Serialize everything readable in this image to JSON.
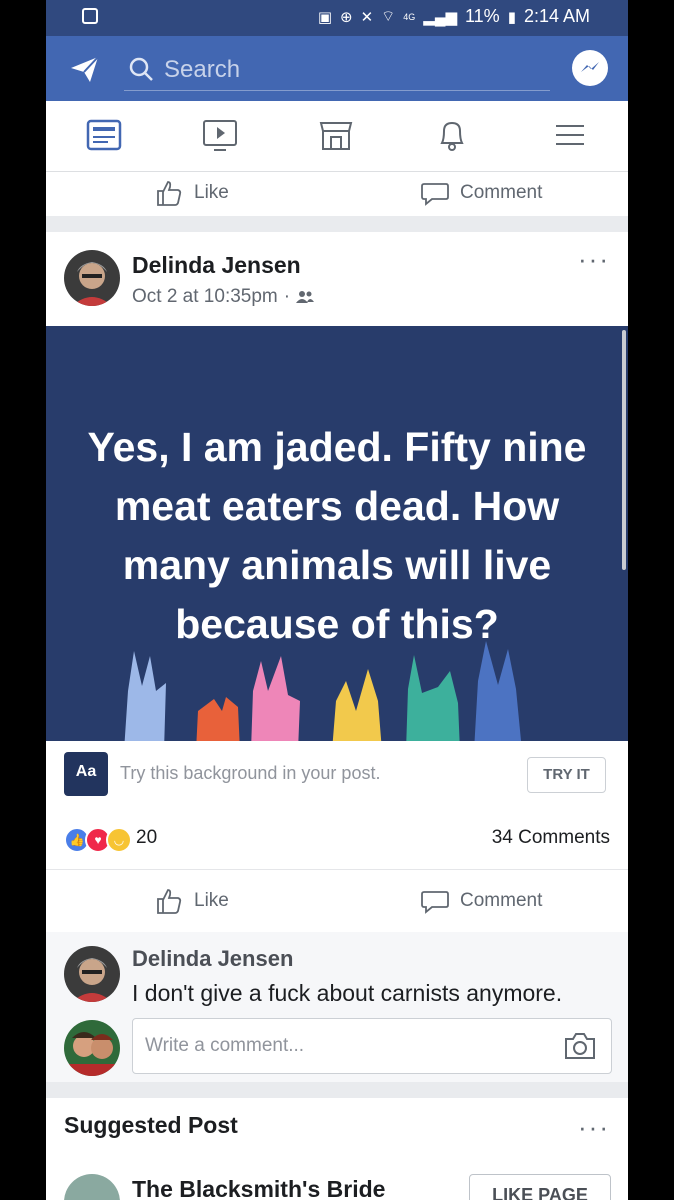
{
  "status_bar": {
    "battery": "11%",
    "time": "2:14 AM",
    "network": "4G"
  },
  "header": {
    "search_placeholder": "Search"
  },
  "top_actions": {
    "like_label": "Like",
    "comment_label": "Comment"
  },
  "post": {
    "author": "Delinda Jensen",
    "timestamp": "Oct 2 at 10:35pm",
    "separator": "·",
    "more_label": "···",
    "text": "Yes, I  am jaded. Fifty nine meat eaters dead. How many animals will live because of this?",
    "background_color": "#283c6b",
    "try_background": {
      "icon_label": "Aa",
      "prompt": "Try this background in your post.",
      "button": "TRY IT"
    },
    "reaction_count": "20",
    "comment_count": "34 Comments",
    "like_label": "Like",
    "comment_label": "Comment"
  },
  "comment": {
    "author": "Delinda Jensen",
    "text": "I  don't give a fuck about carnists anymore.",
    "write_placeholder": "Write a comment..."
  },
  "suggested": {
    "title": "Suggested Post",
    "more_label": "···",
    "page_name": "The Blacksmith's Bride",
    "like_page_button": "LIKE PAGE"
  },
  "colors": {
    "brand": "#4267b2",
    "status_bar": "#30497f",
    "active_tab": "#4267b2"
  }
}
